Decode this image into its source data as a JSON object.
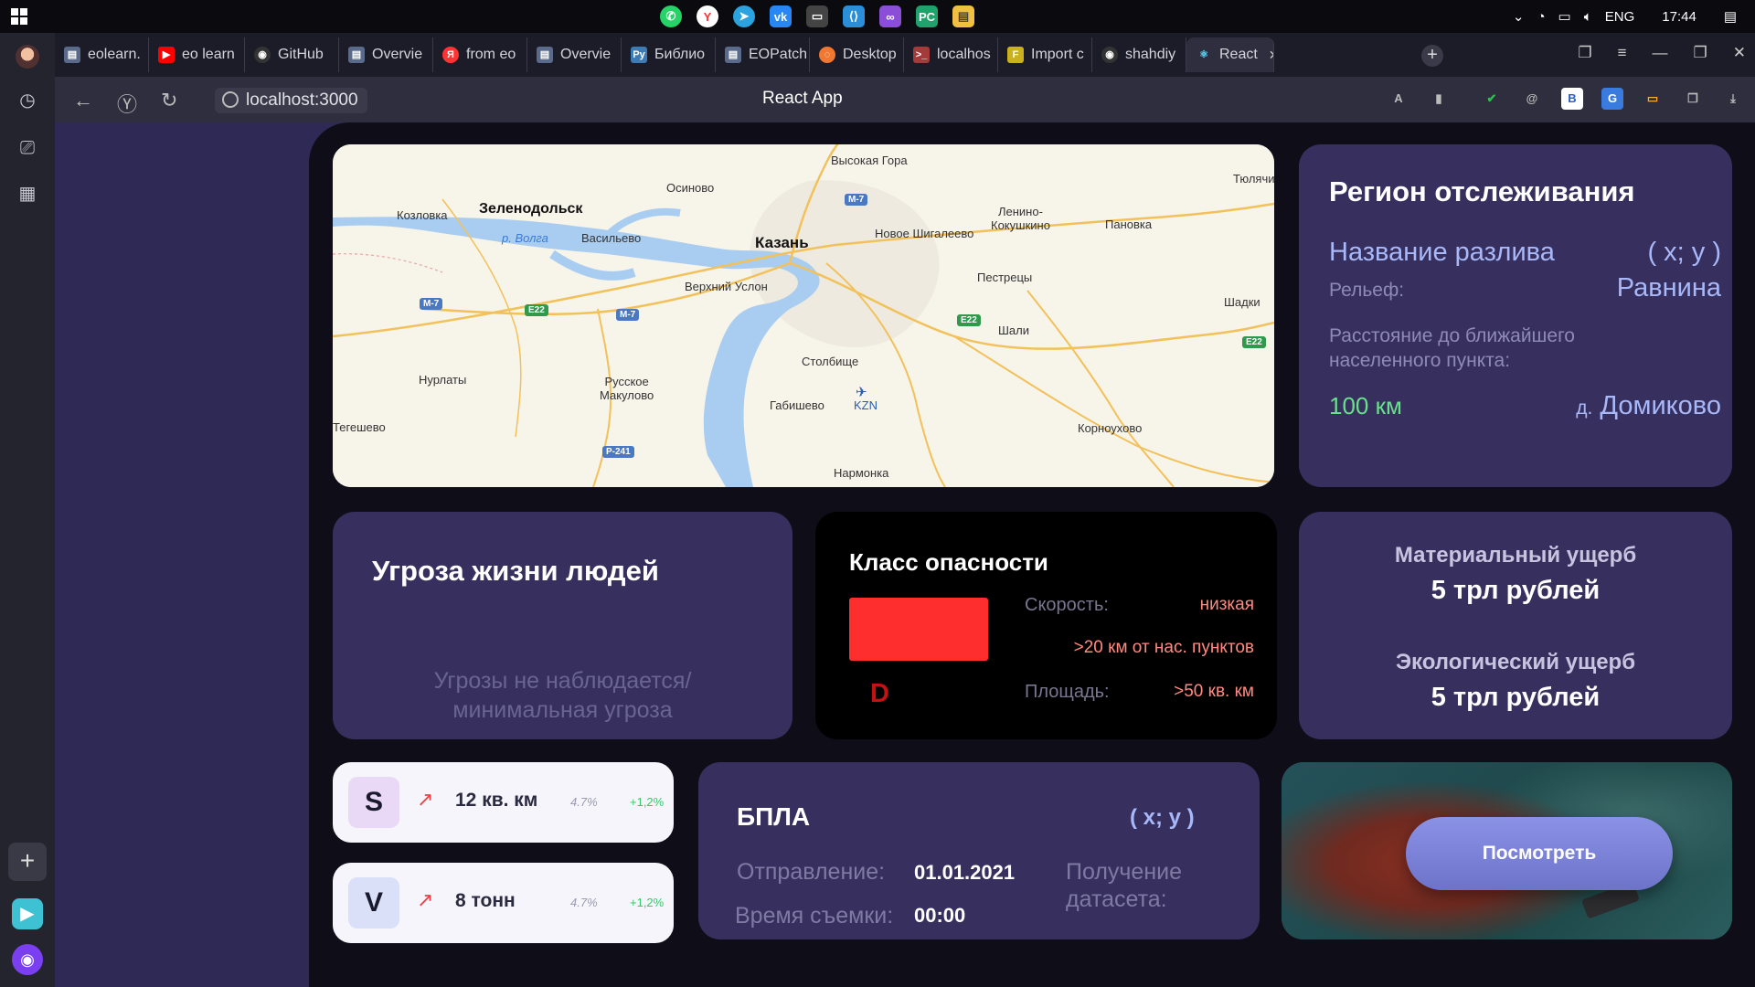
{
  "taskbar": {
    "tray": {
      "lang": "ENG",
      "time": "17:44"
    },
    "apps": [
      {
        "name": "whatsapp-icon",
        "color": "#25d366"
      },
      {
        "name": "yandex-icon",
        "color": "#ff3333"
      },
      {
        "name": "telegram-icon",
        "color": "#2aa3df"
      },
      {
        "name": "vk-icon",
        "color": "#2787f5"
      },
      {
        "name": "terminal-icon",
        "color": "#444"
      },
      {
        "name": "vscode-icon",
        "color": "#2a8fd8"
      },
      {
        "name": "visual-studio-icon",
        "color": "#8a4fd6"
      },
      {
        "name": "pycharm-icon",
        "color": "#1fa26b"
      },
      {
        "name": "file-explorer-icon",
        "color": "#f0c040"
      }
    ]
  },
  "browser": {
    "tabs": [
      {
        "label": "eolearn.",
        "color": "#5a6a8a"
      },
      {
        "label": "eo learn",
        "color": "#ff0000"
      },
      {
        "label": "GitHub",
        "color": "#333"
      },
      {
        "label": "Overvie",
        "color": "#5a6a8a"
      },
      {
        "label": "from eo",
        "color": "#ff3333"
      },
      {
        "label": "Overvie",
        "color": "#5a6a8a"
      },
      {
        "label": "Библио",
        "color": "#3d7bb5"
      },
      {
        "label": "EOPatch",
        "color": "#5a6a8a"
      },
      {
        "label": "Desktop",
        "color": "#f07830"
      },
      {
        "label": "localhos",
        "color": "#a43a3a"
      },
      {
        "label": "Import c",
        "color": "#c9b21a"
      },
      {
        "label": "shahdiy",
        "color": "#333"
      },
      {
        "label": "React",
        "color": "#2aa9c9"
      }
    ],
    "url": "localhost:3000",
    "page_title": "React App"
  },
  "map": {
    "labels": {
      "kazan": "Казань",
      "zelenodolsk": "Зеленодольск",
      "vysokaya_gora": "Высокая Гора",
      "osinovo": "Осиново",
      "kozlovka": "Козловка",
      "volga": "р. Волга",
      "vasilyevo": "Васильево",
      "novoe_shigaleevo": "Новое Шигалеево",
      "lenino": "Ленино-\nКокушкино",
      "panovka": "Пановка",
      "tyulyachi": "Тюлячи",
      "verkhny_uslon": "Верхний Услон",
      "pestretsy": "Пестрецы",
      "shadki": "Шадки",
      "shali": "Шали",
      "stolbishche": "Столбище",
      "nurlaty": "Нурлаты",
      "russkoe_makulovo": "Русское\nМакулово",
      "gabishevo": "Габишево",
      "kzn": "KZN",
      "tegeshevo": "Тегешево",
      "kornoukhovo": "Корноухово",
      "narmonka": "Нармонка"
    },
    "shields": {
      "m7": "M-7",
      "e22": "E22",
      "p241": "Р-241"
    }
  },
  "region": {
    "title": "Регион отслеживания",
    "spill_name": "Название разлива",
    "coords": "( x; y )",
    "relief_label": "Рельеф:",
    "relief_value": "Равнина",
    "distance_label": "Расстояние до ближайшего населенного пункта:",
    "distance_value": "100 км",
    "village_prefix": "д.",
    "village_name": "Домиково"
  },
  "threat": {
    "title": "Угроза жизни людей",
    "status_line1": "Угрозы не наблюдается/",
    "status_line2": "минимальная угроза"
  },
  "danger": {
    "title": "Класс опасности",
    "color": "#ff2e2e",
    "class": "D",
    "speed_label": "Скорость:",
    "speed_value": "низкая",
    "distance_value": ">20 км от нас. пунктов",
    "area_label": "Площадь:",
    "area_value": ">50 кв. км"
  },
  "damage": {
    "material_label": "Материальный ущерб",
    "material_value": "5 трл рублей",
    "eco_label": "Экологический ущерб",
    "eco_value": "5 трл рублей"
  },
  "stats": [
    {
      "badge": "S",
      "badge_color": "#ead9f6",
      "value": "12 кв. км",
      "pct": "4.7%",
      "delta": "+1,2%"
    },
    {
      "badge": "V",
      "badge_color": "#d9e0f8",
      "value": "8 тонн",
      "pct": "4.7%",
      "delta": "+1,2%"
    }
  ],
  "drone": {
    "title": "БПЛА",
    "coords": "( x; y )",
    "departure_label": "Отправление:",
    "departure_value": "01.01.2021",
    "shot_time_label": "Время съемки:",
    "shot_time_value": "00:00",
    "dataset_label_1": "Получение",
    "dataset_label_2": "датасета:"
  },
  "image_card": {
    "button_label": "Посмотреть"
  }
}
